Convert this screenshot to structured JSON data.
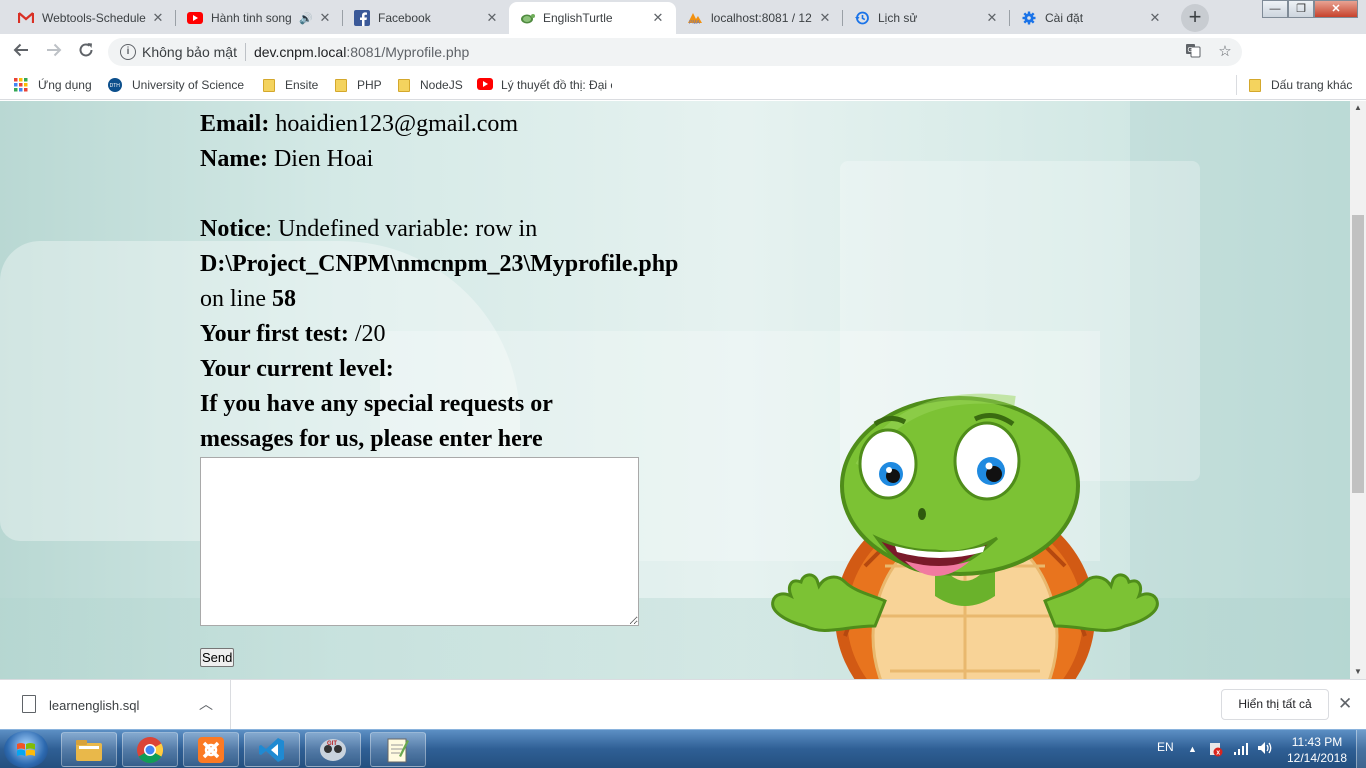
{
  "browser": {
    "tabs": [
      {
        "label": "Webtools-Schedule",
        "icon": "gmail-icon",
        "color": "#d93025"
      },
      {
        "label": "Hành tinh song",
        "icon": "youtube-icon",
        "color": "#ff0000",
        "audio": true
      },
      {
        "label": "Facebook",
        "icon": "facebook-icon",
        "color": "#1877f2"
      },
      {
        "label": "EnglishTurtle",
        "icon": "turtle-icon",
        "color": "#6a9a5a",
        "active": true
      },
      {
        "label": "localhost:8081 / 12",
        "icon": "phpmyadmin-icon",
        "color": "#f29111"
      },
      {
        "label": "Lịch sử",
        "icon": "history-icon",
        "color": "#1a73e8"
      },
      {
        "label": "Cài đặt",
        "icon": "settings-icon",
        "color": "#1a73e8"
      }
    ],
    "new_tab_symbol": "+",
    "window_controls": {
      "minimize": "—",
      "maximize": "❐",
      "close": "✕"
    },
    "address": {
      "security_label": "Không bảo mật",
      "host": "dev.cnpm.local",
      "path": ":8081/Myprofile.php"
    },
    "bookmarks": [
      {
        "label": "Ứng dụng",
        "icon": "apps-icon"
      },
      {
        "label": "University of Science",
        "icon": "university-icon"
      },
      {
        "label": "Ensite",
        "icon": "folder-icon"
      },
      {
        "label": "PHP",
        "icon": "folder-icon"
      },
      {
        "label": "NodeJS",
        "icon": "folder-icon"
      },
      {
        "label": "Lý thuyết đồ thị: Đại c",
        "icon": "youtube-icon"
      }
    ],
    "other_bookmarks": "Dấu trang khác"
  },
  "page": {
    "email_label": "Email:",
    "email_value": "hoaidien123@gmail.com",
    "name_label": "Name:",
    "name_value": "Dien Hoai",
    "notice_label": "Notice",
    "notice_text": ": Undefined variable: row in",
    "notice_path": "D:\\Project_CNPM\\nmcnpm_23\\Myprofile.php",
    "notice_online": "on line",
    "notice_line": "58",
    "first_test_label": "Your first test:",
    "first_test_value": "/20",
    "level_label": "Your current level:",
    "request_label": "If you have any special requests or messages for us, please enter here",
    "message_value": "",
    "send_label": "Send"
  },
  "downloads": {
    "file_name": "learnenglish.sql",
    "show_all": "Hiển thị tất cả"
  },
  "taskbar": {
    "apps": [
      "file-explorer-icon",
      "chrome-icon",
      "xampp-icon",
      "vscode-icon",
      "git-icon",
      "notepad-icon"
    ],
    "language": "EN",
    "time": "11:43 PM",
    "date": "12/14/2018"
  }
}
